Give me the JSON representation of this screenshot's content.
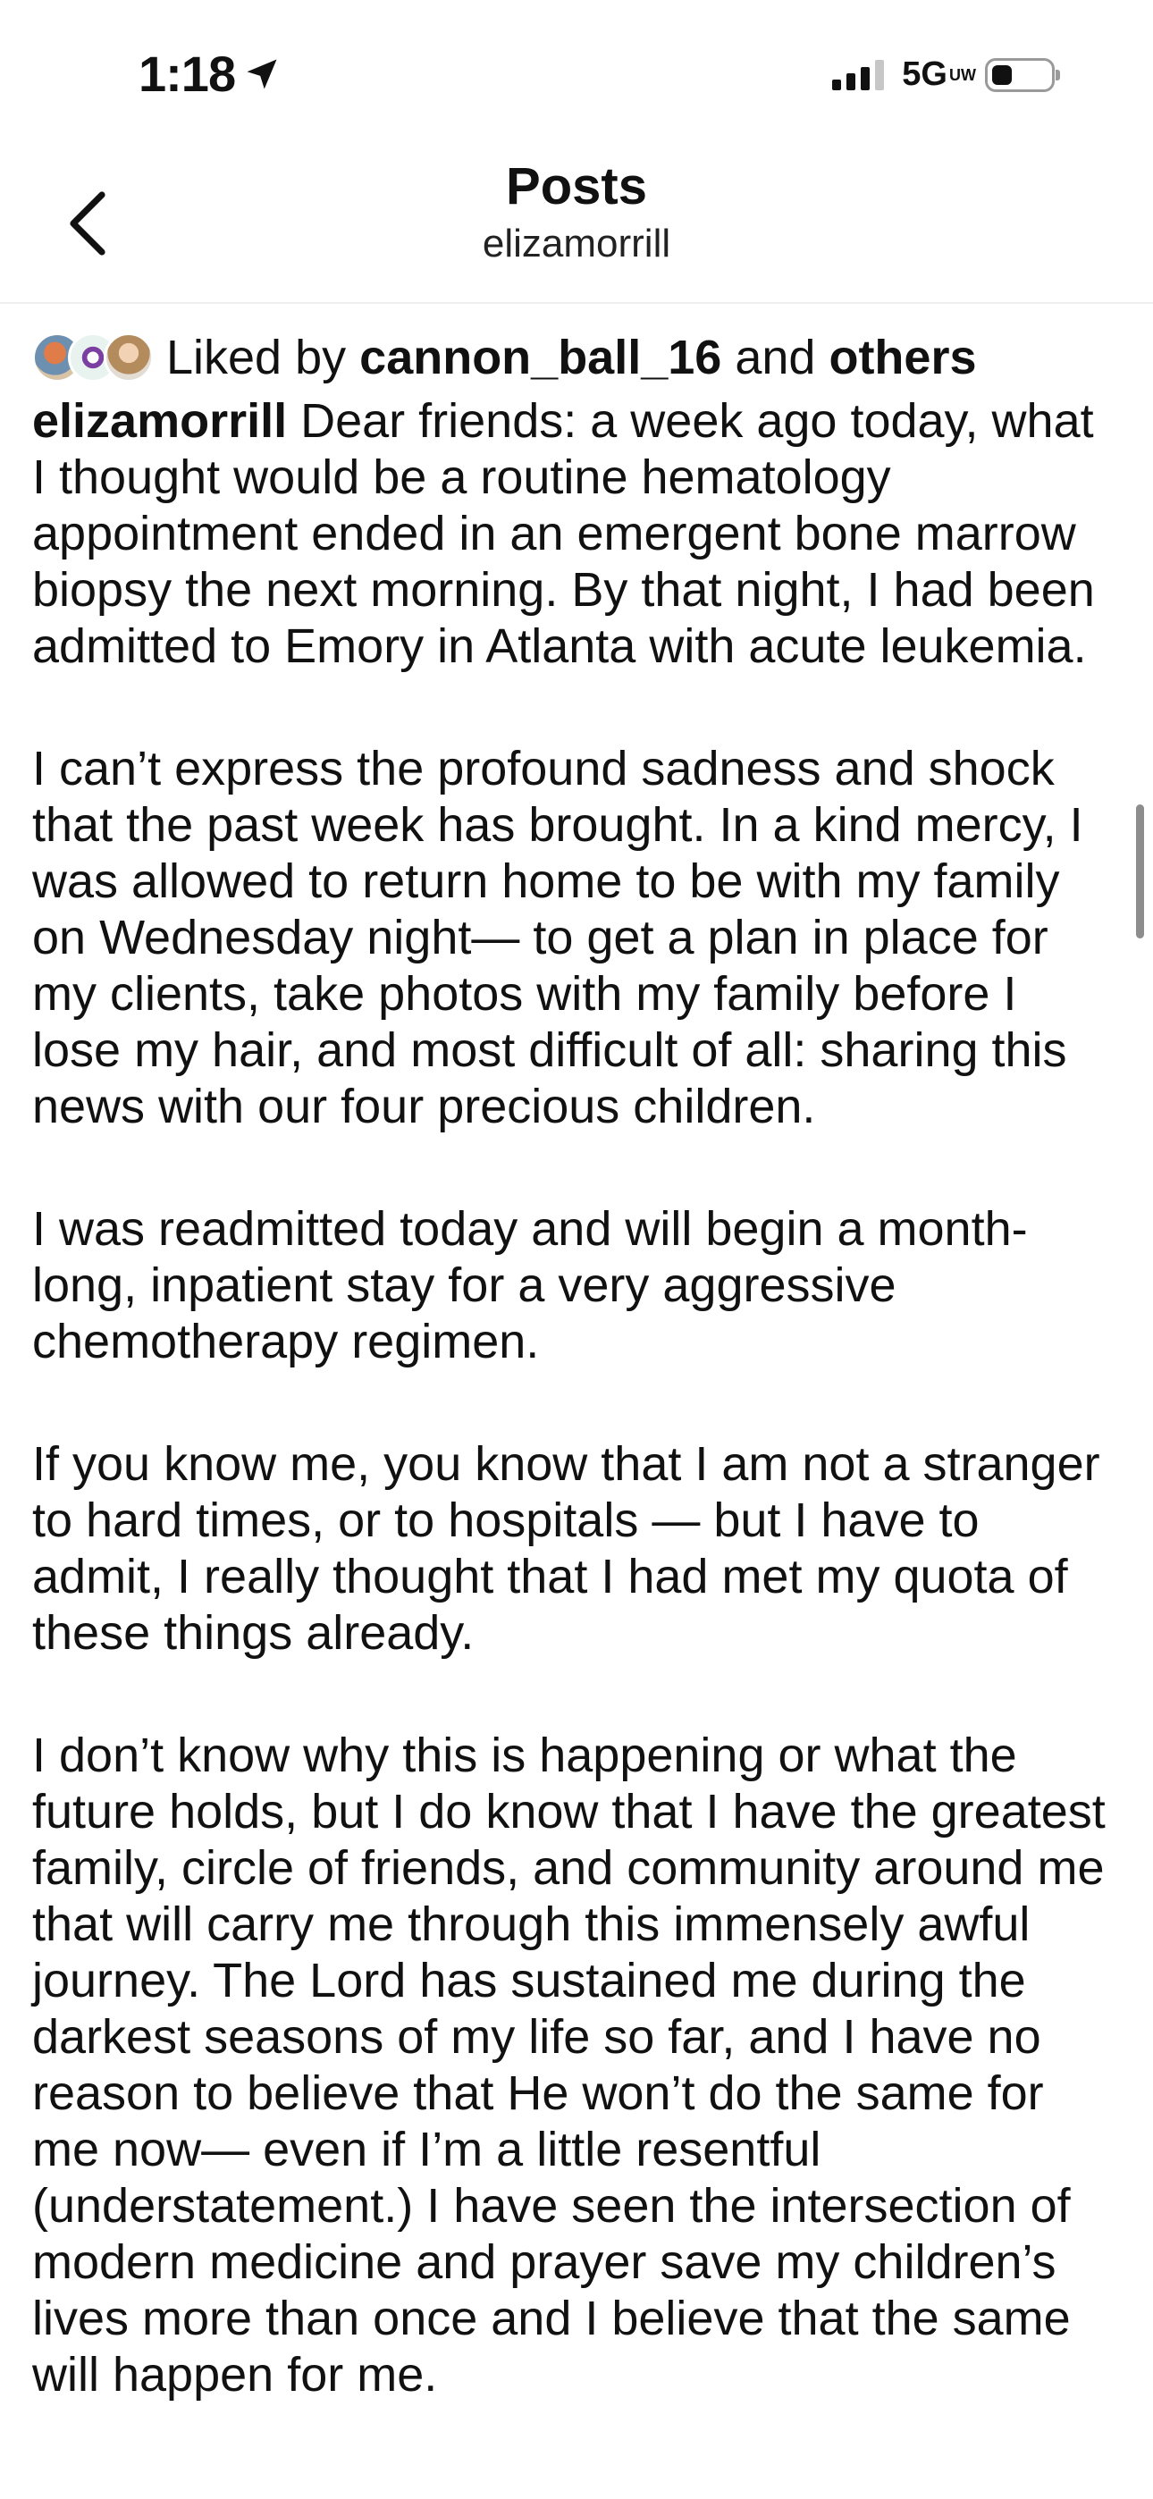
{
  "status_bar": {
    "time": "1:18",
    "network": "5G",
    "network_badge": "UW"
  },
  "nav": {
    "title": "Posts",
    "subtitle": "elizamorrill"
  },
  "likes": {
    "prefix": "Liked by",
    "user": "cannon_ball_16",
    "joiner": "and",
    "others": "others"
  },
  "post": {
    "username": "elizamorrill",
    "paragraphs": [
      "Dear friends: a week ago today, what I thought would be a routine hematology appointment ended in an emergent bone marrow biopsy the next morning. By that night, I had been admitted to Emory in Atlanta with acute leukemia.",
      "I can’t express the profound sadness and shock that the past week has brought. In a kind mercy, I was allowed to return home to be with my family on Wednesday night— to get a plan in place for my clients, take photos with my family before I lose my hair, and most difficult of all: sharing this news with our four precious children.",
      "I was readmitted today and will begin a month-long, inpatient stay for a very aggressive chemotherapy regimen.",
      "If you know me, you know that I am not a stranger to hard times, or to hospitals — but I have to admit, I really thought that I had met my quota of these things already.",
      "I don’t know why this is happening or what the future holds, but I do know that I have the greatest family, circle of friends, and community around me that will carry me through this immensely awful journey. The Lord has sustained me during the darkest seasons of my life so far, and I have no reason to believe that He won’t do the same for me now— even if I’m a little resentful (understatement.) I have seen the intersection of modern medicine and prayer save my children’s lives more than once and I believe that the same will happen for me."
    ]
  }
}
